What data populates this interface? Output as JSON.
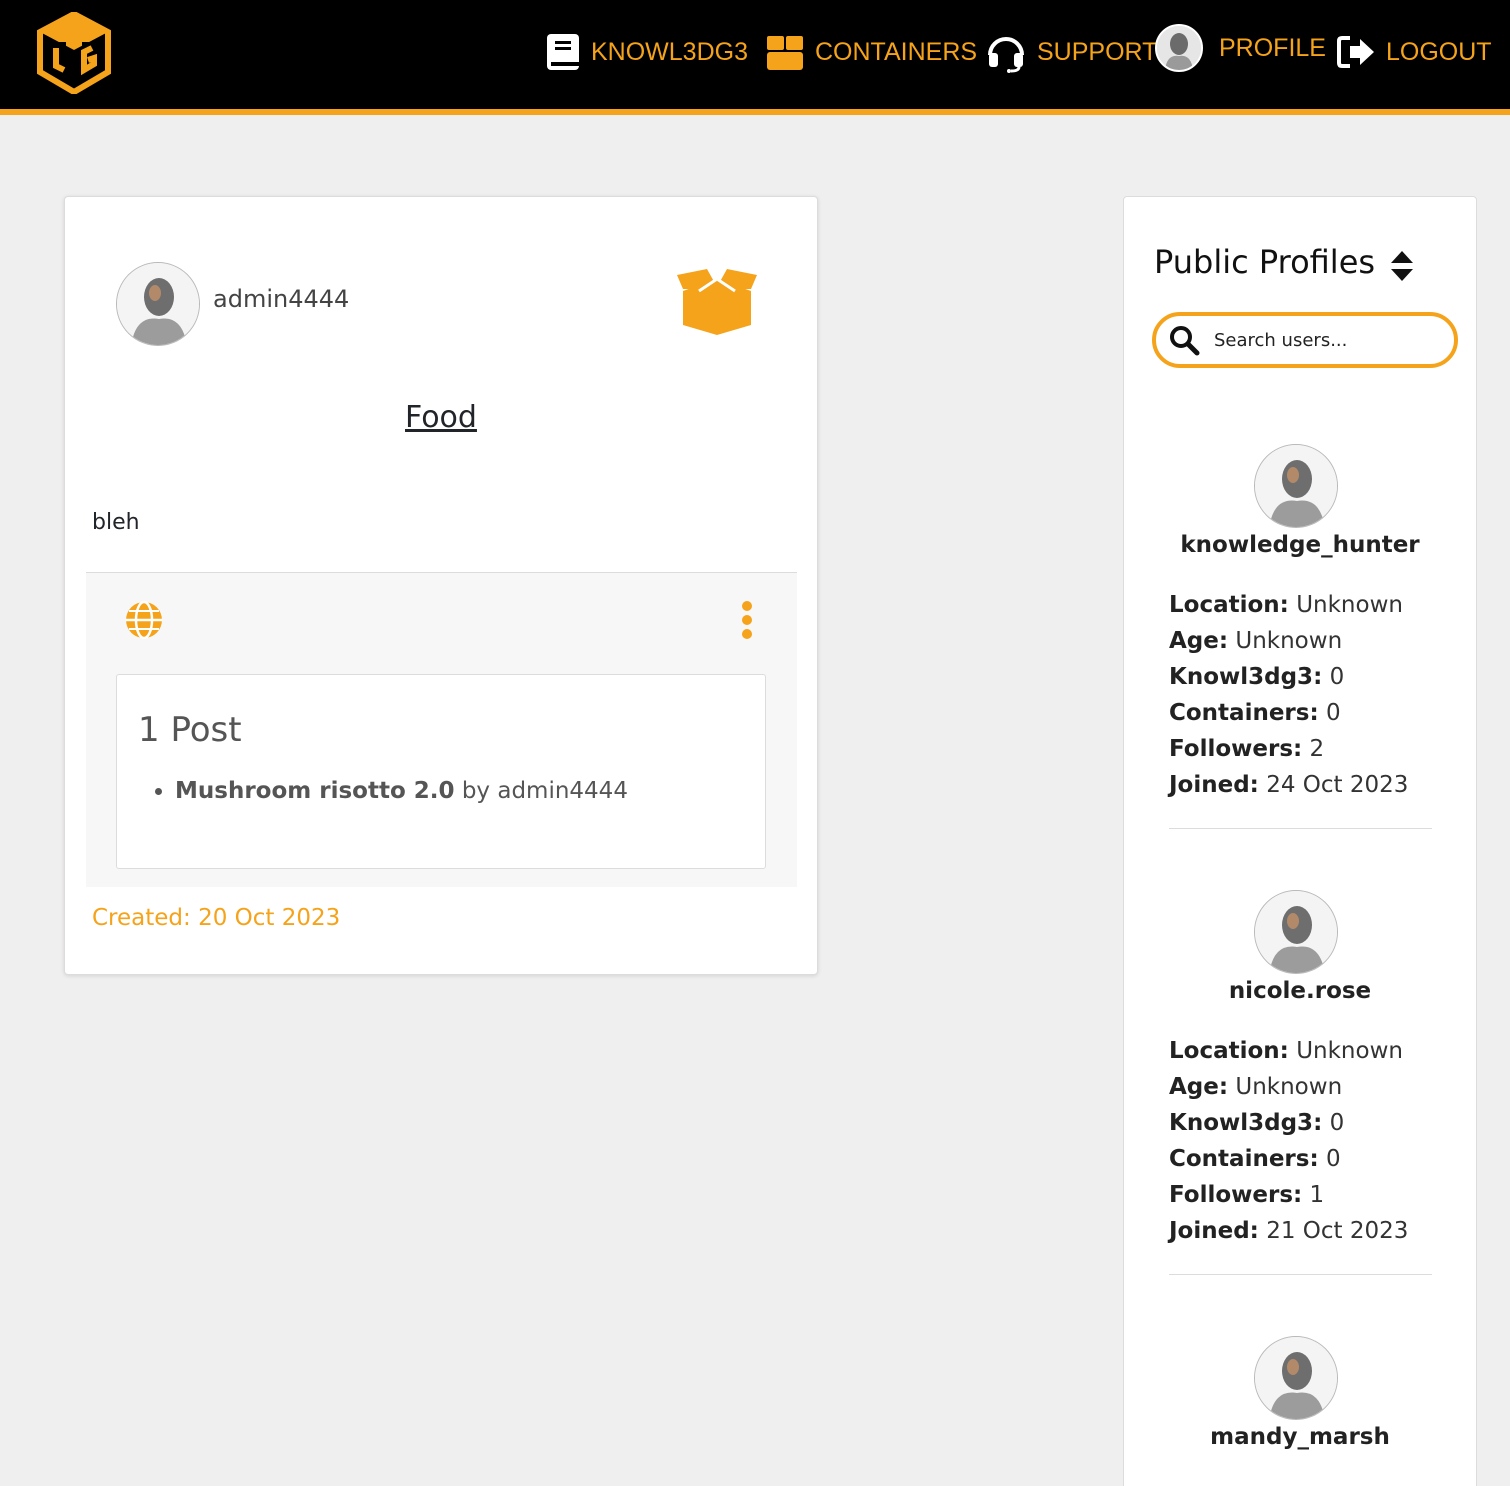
{
  "nav": {
    "items": [
      {
        "label": "KNOWL3DG3",
        "icon": "book-icon"
      },
      {
        "label": "CONTAINERS",
        "icon": "box-icon"
      },
      {
        "label": "SUPPORT",
        "icon": "headset-icon"
      },
      {
        "label": "PROFILE",
        "icon": "avatar"
      },
      {
        "label": "LOGOUT",
        "icon": "logout-icon"
      }
    ],
    "accent_color": "#f5a31a"
  },
  "container": {
    "owner": "admin4444",
    "title": "Food",
    "description": "bleh",
    "visibility_icon": "globe-icon",
    "posts_heading": "1 Post",
    "posts": [
      {
        "title": "Mushroom risotto 2.0",
        "by": "by admin4444"
      }
    ],
    "created": "Created: 20 Oct 2023"
  },
  "sidebar": {
    "title": "Public Profiles",
    "search_placeholder": "Search users...",
    "labels": {
      "location": "Location:",
      "age": "Age:",
      "knowledge": "Knowl3dg3:",
      "containers": "Containers:",
      "followers": "Followers:",
      "joined": "Joined:"
    },
    "profiles": [
      {
        "name": "knowledge_hunter",
        "location": "Unknown",
        "age": "Unknown",
        "knowledge": "0",
        "containers": "0",
        "followers": "2",
        "joined": "24 Oct 2023"
      },
      {
        "name": "nicole.rose",
        "location": "Unknown",
        "age": "Unknown",
        "knowledge": "0",
        "containers": "0",
        "followers": "1",
        "joined": "21 Oct 2023"
      },
      {
        "name": "mandy_marsh"
      }
    ]
  }
}
